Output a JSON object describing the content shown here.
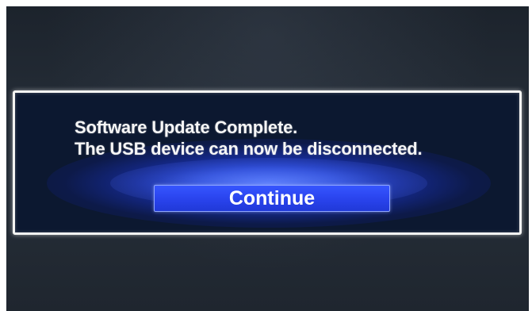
{
  "dialog": {
    "line1": "Software Update Complete.",
    "line2": "The USB device can now be disconnected.",
    "continue_label": "Continue"
  },
  "colors": {
    "screen_background": "#232b35",
    "dialog_border": "#f4f4f2",
    "button_fill": "#2a44ee",
    "glow": "#3c64ff",
    "text": "#f6f6f6"
  }
}
